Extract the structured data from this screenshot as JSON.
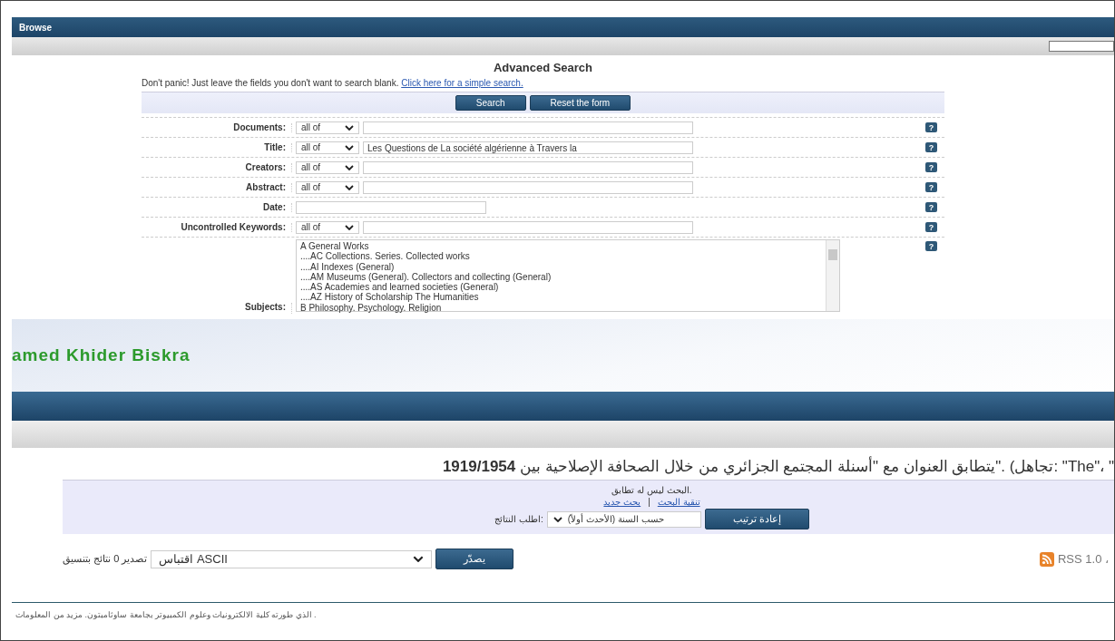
{
  "top": {
    "nav_title": "Browse",
    "heading": "Advanced Search",
    "intro": "Don't panic! Just leave the fields you don't want to search blank.",
    "simple_link": "Click here for a simple search.",
    "buttons": [
      "Search",
      "Reset the form"
    ],
    "fields": [
      {
        "kind": "match",
        "label": "Documents:",
        "match": "all of",
        "help": "?"
      },
      {
        "kind": "match",
        "label": "Title:",
        "match": "all of",
        "value": "Les Questions de La société algérienne à Travers la",
        "help": "?"
      },
      {
        "kind": "match",
        "label": "Creators:",
        "match": "all of",
        "help": "?"
      },
      {
        "kind": "match",
        "label": "Abstract:",
        "match": "all of",
        "help": "?"
      },
      {
        "kind": "date",
        "label": "Date:",
        "help": "?"
      },
      {
        "kind": "match",
        "label": "Uncontrolled Keywords:",
        "match": "all of",
        "help": "?"
      },
      {
        "kind": "list",
        "label": "Subjects:",
        "help": "?",
        "options": [
          {
            "text": "A General Works",
            "children": [
              {
                "text": "....AC Collections. Series. Collected works"
              },
              {
                "text": "....AI Indexes (General)"
              },
              {
                "text": "....AM Museums (General). Collectors and collecting (General)"
              },
              {
                "text": "....AS Academies and learned societies (General)"
              },
              {
                "text": "....AZ History of Scholarship The Humanities"
              }
            ]
          },
          {
            "text": "B Philosophy. Psychology. Religion"
          }
        ]
      }
    ]
  },
  "bottom": {
    "banner_text": "amed Khider Biskra",
    "heading": "\" ،\"The\" :تجاهل) .\"يتطابق العنوان مع \"أسنلة المجتمع الجزائري من خلال الصحافة الإصلاحية بين **1919/1954**",
    "no_match": ".البحث ليس له تطابق",
    "links": [
      "تنقية البحث",
      "بحث جديد"
    ],
    "link_separator": "|",
    "sort_button": "إعادة ترتيب",
    "sort_value": "حسب السنة (الأحدث أولاً)",
    "sort_label": ":اطلب النتائج",
    "export_label": "تصدير 0 نتائج بتنسيق",
    "export_value": "اقتباس ASCII",
    "export_button": "يصدّر",
    "rss": "RSS 1.0 ،",
    "footer": ". الذي طورته كلية الالكترونيات وعلوم الكمبيوتر بجامعة ساوثامبتون. مزيد من المعلومات"
  }
}
